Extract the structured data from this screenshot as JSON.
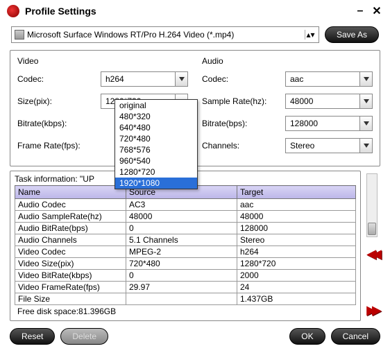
{
  "window": {
    "title": "Profile Settings"
  },
  "profile": {
    "text": "Microsoft Surface Windows RT/Pro H.264 Video (*.mp4)"
  },
  "buttons": {
    "saveas": "Save As",
    "reset": "Reset",
    "delete": "Delete",
    "ok": "OK",
    "cancel": "Cancel"
  },
  "video": {
    "heading": "Video",
    "codec_label": "Codec:",
    "codec": "h264",
    "size_label": "Size(pix):",
    "size": "1280*720",
    "bitrate_label": "Bitrate(kbps):",
    "bitrate": "",
    "framerate_label": "Frame Rate(fps):",
    "framerate": "",
    "size_options": [
      "original",
      "480*320",
      "640*480",
      "720*480",
      "768*576",
      "960*540",
      "1280*720",
      "1920*1080"
    ],
    "size_selected_index": 7
  },
  "audio": {
    "heading": "Audio",
    "codec_label": "Codec:",
    "codec": "aac",
    "samplerate_label": "Sample Rate(hz):",
    "samplerate": "48000",
    "bitrate_label": "Bitrate(bps):",
    "bitrate": "128000",
    "channels_label": "Channels:",
    "channels": "Stereo"
  },
  "task": {
    "info_prefix": "Task information: \"UP",
    "headers": [
      "Name",
      "Source",
      "Target"
    ],
    "rows": [
      [
        "Audio Codec",
        "AC3",
        "aac"
      ],
      [
        "Audio SampleRate(hz)",
        "48000",
        "48000"
      ],
      [
        "Audio BitRate(bps)",
        "0",
        "128000"
      ],
      [
        "Audio Channels",
        "5.1 Channels",
        "Stereo"
      ],
      [
        "Video Codec",
        "MPEG-2",
        "h264"
      ],
      [
        "Video Size(pix)",
        "720*480",
        "1280*720"
      ],
      [
        "Video BitRate(kbps)",
        "0",
        "2000"
      ],
      [
        "Video FrameRate(fps)",
        "29.97",
        "24"
      ],
      [
        "File Size",
        "",
        "1.437GB"
      ]
    ],
    "freedisk": "Free disk space:81.396GB"
  }
}
